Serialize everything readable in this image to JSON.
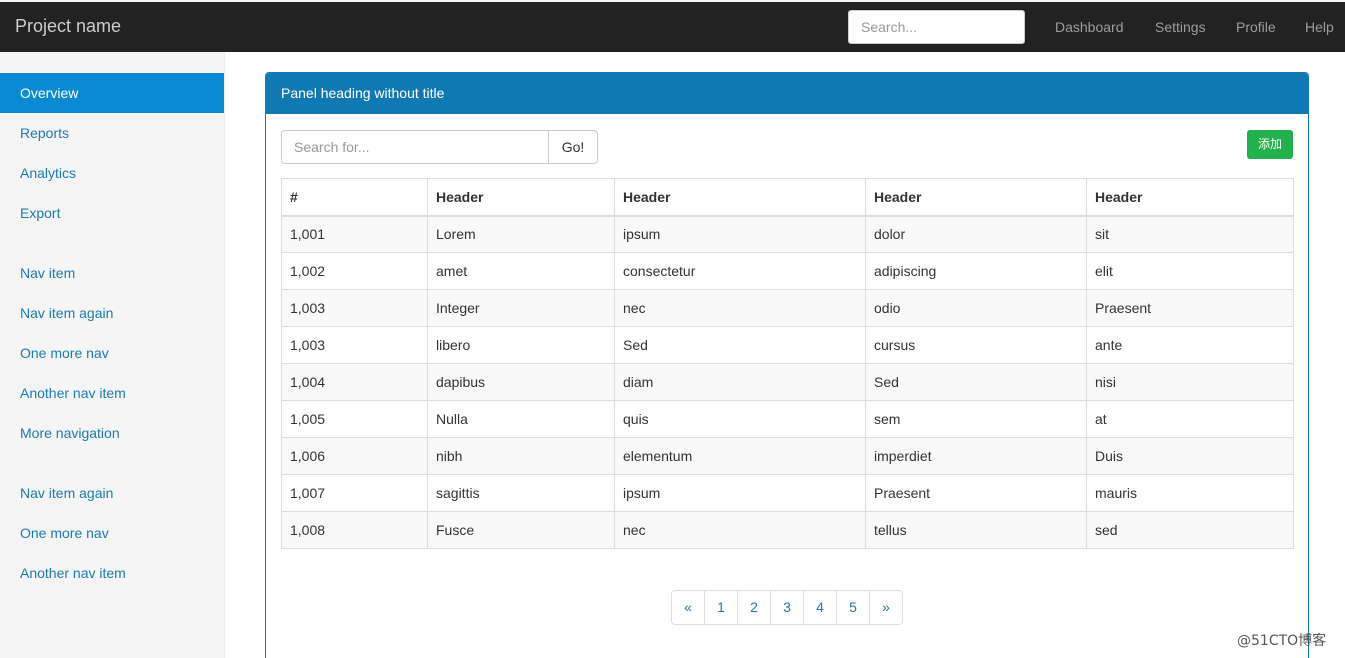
{
  "navbar": {
    "brand": "Project name",
    "search_placeholder": "Search...",
    "links": [
      "Dashboard",
      "Settings",
      "Profile",
      "Help"
    ]
  },
  "sidebar": {
    "items": [
      "Overview",
      "Reports",
      "Analytics",
      "Export",
      "Nav item",
      "Nav item again",
      "One more nav",
      "Another nav item",
      "More navigation",
      "Nav item again",
      "One more nav",
      "Another nav item"
    ],
    "active": "Overview"
  },
  "panel": {
    "heading": "Panel heading without title",
    "search_placeholder": "Search for...",
    "go_label": "Go!",
    "add_label": "添加"
  },
  "table": {
    "headers": [
      "#",
      "Header",
      "Header",
      "Header",
      "Header"
    ],
    "rows": [
      [
        "1,001",
        "Lorem",
        "ipsum",
        "dolor",
        "sit"
      ],
      [
        "1,002",
        "amet",
        "consectetur",
        "adipiscing",
        "elit"
      ],
      [
        "1,003",
        "Integer",
        "nec",
        "odio",
        "Praesent"
      ],
      [
        "1,003",
        "libero",
        "Sed",
        "cursus",
        "ante"
      ],
      [
        "1,004",
        "dapibus",
        "diam",
        "Sed",
        "nisi"
      ],
      [
        "1,005",
        "Nulla",
        "quis",
        "sem",
        "at"
      ],
      [
        "1,006",
        "nibh",
        "elementum",
        "imperdiet",
        "Duis"
      ],
      [
        "1,007",
        "sagittis",
        "ipsum",
        "Praesent",
        "mauris"
      ],
      [
        "1,008",
        "Fusce",
        "nec",
        "tellus",
        "sed"
      ]
    ]
  },
  "pagination": [
    "«",
    "1",
    "2",
    "3",
    "4",
    "5",
    "»"
  ],
  "watermark": "@51CTO博客",
  "colors": {
    "navbar_bg": "#222222",
    "active_nav": "#0a8ad0",
    "panel_primary": "#1079b3",
    "add_button": "#22b14c",
    "link": "#1b7ab8"
  }
}
